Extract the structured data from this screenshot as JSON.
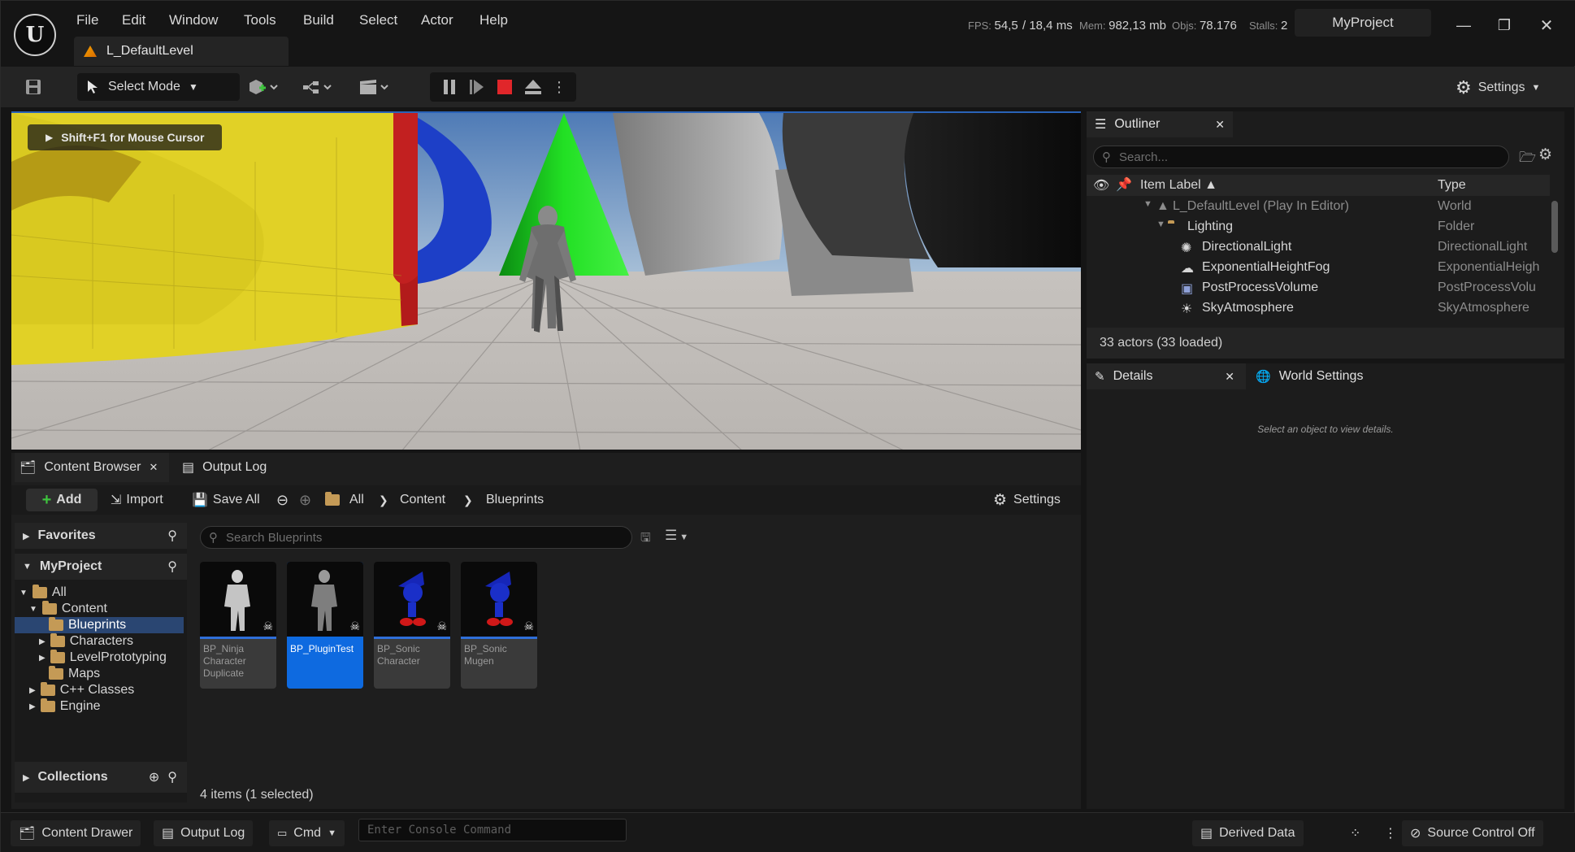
{
  "app": {
    "logo_glyph": "U",
    "project_name": "MyProject"
  },
  "menu": [
    "File",
    "Edit",
    "Window",
    "Tools",
    "Build",
    "Select",
    "Actor",
    "Help"
  ],
  "level_tab": {
    "label": "L_DefaultLevel"
  },
  "stats": {
    "fps_label": "FPS:",
    "fps_value": "54,5",
    "ms_value": "/ 18,4 ms",
    "mem_label": "Mem:",
    "mem_value": "982,13 mb",
    "objs_label": "Objs:",
    "objs_value": "78.176",
    "stalls_label": "Stalls:",
    "stalls_value": "2"
  },
  "window_buttons": {
    "minimize": "—",
    "restore": "❐",
    "close": "✕"
  },
  "toolbar": {
    "mode_label": "Select Mode",
    "settings_label": "Settings"
  },
  "viewport": {
    "hint": "Shift+F1 for Mouse Cursor"
  },
  "outliner": {
    "tab_label": "Outliner",
    "search_placeholder": "Search...",
    "col_label": "Item Label ▲",
    "col_type": "Type",
    "rows": [
      {
        "label": "L_DefaultLevel (Play In Editor)",
        "type": "World"
      },
      {
        "label": "Lighting",
        "type": "Folder"
      },
      {
        "label": "DirectionalLight",
        "type": "DirectionalLight"
      },
      {
        "label": "ExponentialHeightFog",
        "type": "ExponentialHeigh"
      },
      {
        "label": "PostProcessVolume",
        "type": "PostProcessVolu"
      },
      {
        "label": "SkyAtmosphere",
        "type": "SkyAtmosphere"
      }
    ],
    "footer": "33 actors (33 loaded)"
  },
  "details": {
    "tab_label": "Details",
    "world_settings_label": "World Settings",
    "empty_message": "Select an object to view details."
  },
  "content_browser": {
    "tab_label": "Content Browser",
    "output_log_tab": "Output Log",
    "add_label": "Add",
    "import_label": "Import",
    "save_all_label": "Save All",
    "path": [
      "All",
      "Content",
      "Blueprints"
    ],
    "settings_label": "Settings",
    "search_placeholder": "Search Blueprints",
    "favorites_label": "Favorites",
    "project_label": "MyProject",
    "collections_label": "Collections",
    "tree": [
      {
        "label": "All"
      },
      {
        "label": "Content"
      },
      {
        "label": "Blueprints"
      },
      {
        "label": "Characters"
      },
      {
        "label": "LevelPrototyping"
      },
      {
        "label": "Maps"
      },
      {
        "label": "C++ Classes"
      },
      {
        "label": "Engine"
      }
    ],
    "assets": [
      {
        "lines": [
          "BP_Ninja",
          "Character",
          "Duplicate"
        ]
      },
      {
        "lines": [
          "BP_PluginTest"
        ]
      },
      {
        "lines": [
          "BP_Sonic",
          "Character"
        ]
      },
      {
        "lines": [
          "BP_Sonic",
          "Mugen"
        ]
      }
    ],
    "status": "4 items (1 selected)"
  },
  "statusbar": {
    "content_drawer": "Content Drawer",
    "output_log": "Output Log",
    "cmd": "Cmd",
    "console_placeholder": "Enter Console Command",
    "derived_data": "Derived Data",
    "source_control": "Source Control Off"
  },
  "colors": {
    "accent": "#0e6ae0",
    "stop_red": "#e0262a",
    "folder": "#c49a56"
  }
}
